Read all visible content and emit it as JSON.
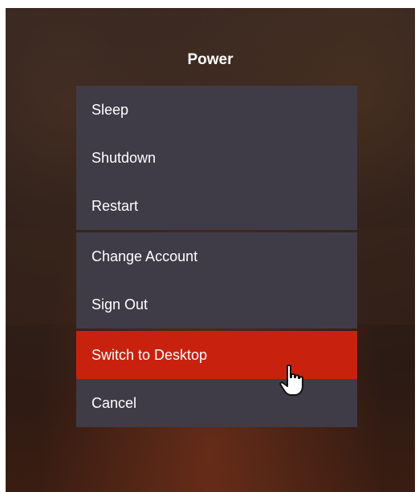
{
  "dialog": {
    "title": "Power"
  },
  "menu": {
    "group1": [
      "Sleep",
      "Shutdown",
      "Restart"
    ],
    "group2": [
      "Change Account",
      "Sign Out"
    ],
    "selected": "Switch to Desktop",
    "cancel": "Cancel"
  },
  "colors": {
    "menu_bg": "#3f3c48",
    "selected_bg": "#c8220f",
    "text": "#ffffff"
  },
  "icons": {
    "cursor": "hand-pointer-icon"
  }
}
